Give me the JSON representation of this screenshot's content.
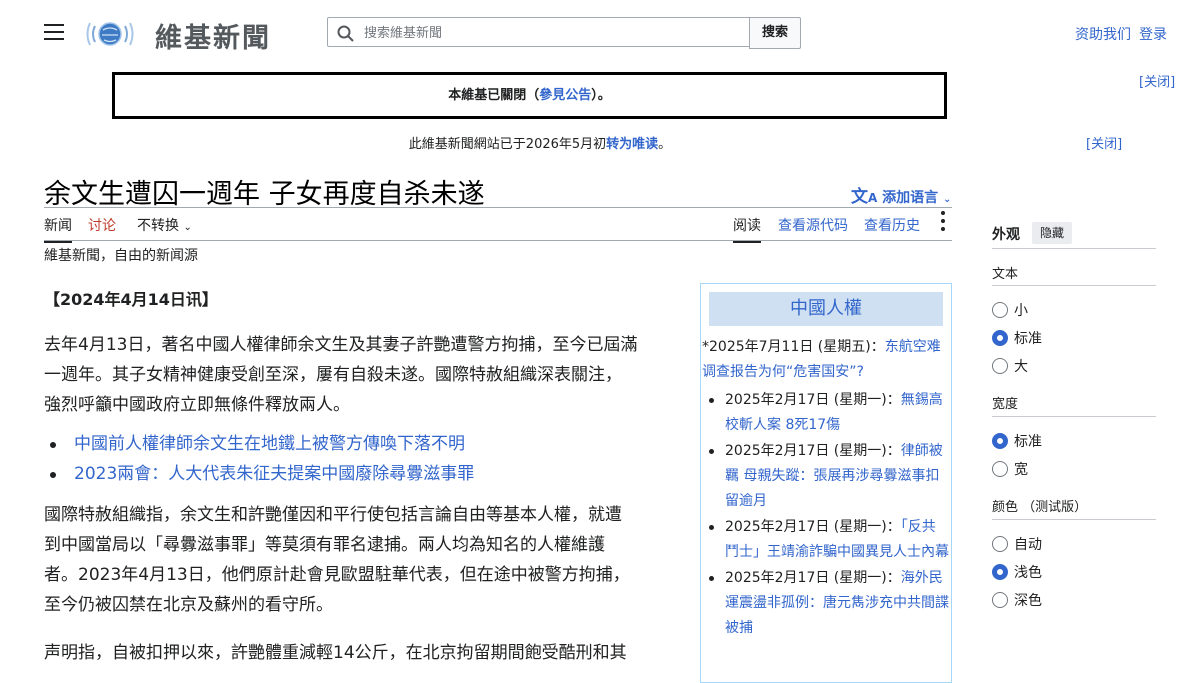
{
  "header": {
    "logo_text": "維基新聞",
    "search_placeholder": "搜索維基新聞",
    "search_button": "搜索",
    "donate": "资助我们",
    "login": "登录"
  },
  "sitenotice": {
    "text_before": "本維基已關閉（",
    "link": "參見公告",
    "text_after": "）。",
    "close": "[关闭]"
  },
  "notice2": {
    "text_before": "此維基新聞網站已于2026年5月初",
    "link": "转为唯读",
    "text_after": "。",
    "close": "[关闭]"
  },
  "page": {
    "title": "余文生遭囚一週年 子女再度自杀未遂",
    "add_language": "添加语言",
    "tabs_left": [
      "新闻",
      "讨论",
      "不转换"
    ],
    "tabs_right": [
      "阅读",
      "查看源代码",
      "查看历史"
    ],
    "tagline": "維基新聞，自由的新闻源"
  },
  "article": {
    "dateline": "【2024年4月14日讯】",
    "para1_lines": [
      "去年4月13日，著名中國人權律師余文生及其妻子許艷遭警方拘捕，至今已屆滿",
      "一週年。其子女精神健康受創至深，屢有自殺未遂。國際特赦組織深表關注，",
      "強烈呼籲中國政府立即無條件釋放兩人。"
    ],
    "links": [
      "中國前人權律師余文生在地鐵上被警方傳喚下落不明",
      "2023兩會：人大代表朱征夫提案中國廢除尋釁滋事罪"
    ],
    "para2_lines": [
      "國際特赦組織指，余文生和許艷僅因和平行使包括言論自由等基本人權，就遭",
      "到中國當局以「尋釁滋事罪」等莫須有罪名逮捕。兩人均為知名的人權維護",
      "者。2023年4月13日，他們原計赴會見歐盟駐華代表，但在途中被警方拘捕，",
      "至今仍被囚禁在北京及蘇州的看守所。"
    ],
    "para3_lines": [
      "声明指，自被扣押以來，許艷體重減輕14公斤，在北京拘留期間飽受酷刑和其"
    ]
  },
  "sidebox": {
    "title": "中國人權",
    "intro_date": "*2025年7月11日 (星期五)：",
    "intro_link": "东航空难调查报告为何“危害国安”?",
    "items": [
      {
        "date": "2025年2月17日 (星期一)：",
        "link": "無錫高校斬人案 8死17傷"
      },
      {
        "date": "2025年2月17日 (星期一)：",
        "link": "律師被羈 母親失蹤：張展再涉尋釁滋事扣留逾月"
      },
      {
        "date": "2025年2月17日 (星期一)：",
        "link": "「反共鬥士」王靖渝詐騙中國異見人士內幕"
      },
      {
        "date": "2025年2月17日 (星期一)：",
        "link": "海外民運震盪非孤例：唐元雋涉充中共間諜被捕"
      }
    ]
  },
  "appearance": {
    "title": "外观",
    "hide": "隐藏",
    "text_head": "文本",
    "text_options": [
      "小",
      "标准",
      "大"
    ],
    "text_selected": 1,
    "width_head": "宽度",
    "width_options": [
      "标准",
      "宽"
    ],
    "width_selected": 0,
    "color_head": "颜色 （测试版）",
    "color_options": [
      "自动",
      "浅色",
      "深色"
    ],
    "color_selected": 1
  },
  "colors": {
    "link": "#3366cc",
    "visited_red": "#bf3c2c",
    "box_title_bg": "#cee0f2"
  }
}
